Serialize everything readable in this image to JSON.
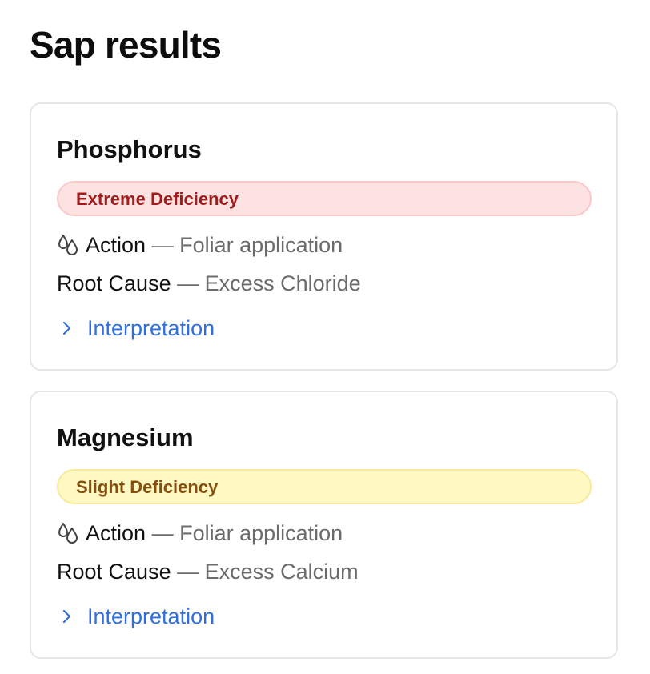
{
  "page": {
    "title": "Sap results"
  },
  "cards": [
    {
      "title": "Phosphorus",
      "badge": "Extreme Deficiency",
      "action_label": "Action",
      "action_sep": "—",
      "action_value": "Foliar application",
      "cause_label": "Root Cause",
      "cause_sep": "—",
      "cause_value": "Excess Chloride",
      "interpretation_label": "Interpretation",
      "action_icon": "droplets-icon",
      "interpretation_icon": "chevron-right-icon"
    },
    {
      "title": "Magnesium",
      "badge": "Slight Deficiency",
      "action_label": "Action",
      "action_sep": "—",
      "action_value": "Foliar application",
      "cause_label": "Root Cause",
      "cause_sep": "—",
      "cause_value": "Excess Calcium",
      "interpretation_label": "Interpretation",
      "action_icon": "droplets-icon",
      "interpretation_icon": "chevron-right-icon"
    }
  ],
  "colors": {
    "extreme_badge_bg": "#fde2e2",
    "extreme_badge_text": "#a11d1d",
    "slight_badge_bg": "#fef9c3",
    "slight_badge_text": "#854d0e",
    "link": "#2f6fde",
    "muted_text": "#6b6b6b"
  }
}
